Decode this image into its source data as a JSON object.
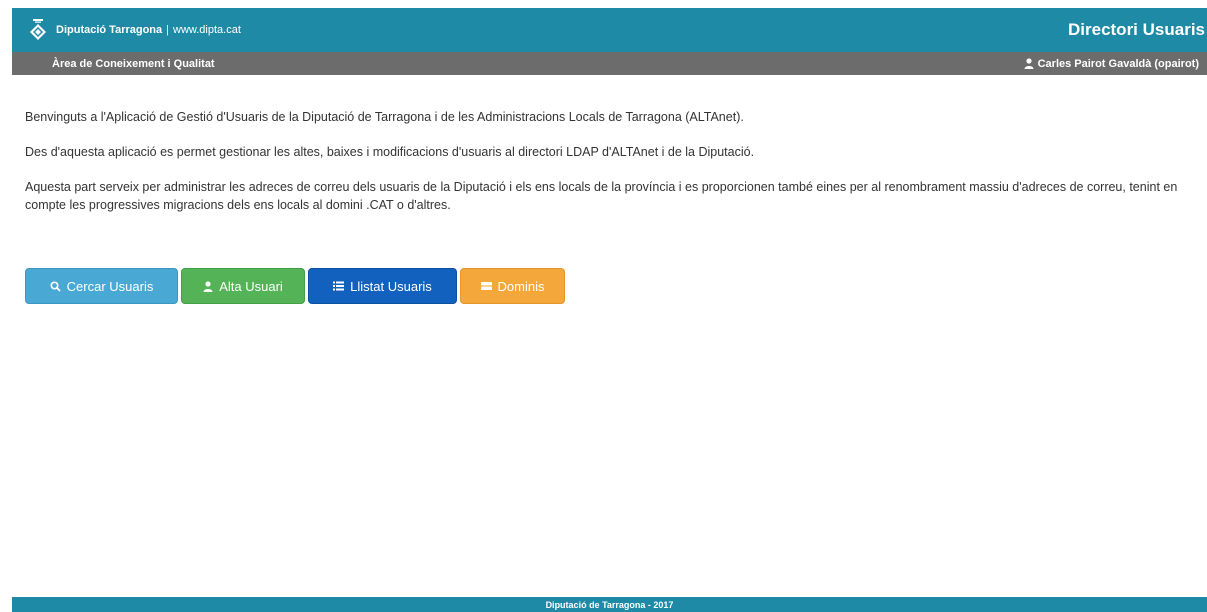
{
  "header": {
    "logo_brand": "Diputació Tarragona",
    "logo_separator": "|",
    "logo_url": "www.dipta.cat",
    "logo_icon": "diputacio-emblem-icon",
    "app_title": "Directori Usuaris"
  },
  "subheader": {
    "area": "Àrea de Coneixement i Qualitat",
    "user_icon": "user-icon",
    "user": "Carles Pairot Gavaldà (opairot)"
  },
  "main": {
    "paragraphs": [
      "Benvinguts a l'Aplicació de Gestió d'Usuaris de la Diputació de Tarragona i de les Administracions Locals de Tarragona (ALTAnet).",
      "Des d'aquesta aplicació es permet gestionar les altes, baixes i modificacions d'usuaris al directori LDAP d'ALTAnet i de la Diputació.",
      "Aquesta part serveix per administrar les adreces de correu dels usuaris de la Diputació i els ens locals de la província i es proporcionen també eines per al renombrament massiu d'adreces de correu, tenint en compte les progressives migracions dels ens locals al domini .CAT o d'altres."
    ],
    "buttons": {
      "search": {
        "label": "Cercar Usuaris",
        "icon": "search-icon",
        "color": "#4aa9d4"
      },
      "add": {
        "label": "Alta Usuari",
        "icon": "user-icon",
        "color": "#53b356"
      },
      "list": {
        "label": "Llistat Usuaris",
        "icon": "list-icon",
        "color": "#1261bf"
      },
      "domains": {
        "label": "Dominis",
        "icon": "server-icon",
        "color": "#f4a83c"
      }
    }
  },
  "footer": {
    "text": "Diputació de Tarragona - 2017"
  },
  "colors": {
    "brand": "#1e8aa6",
    "subbar": "#6c6c6c"
  }
}
